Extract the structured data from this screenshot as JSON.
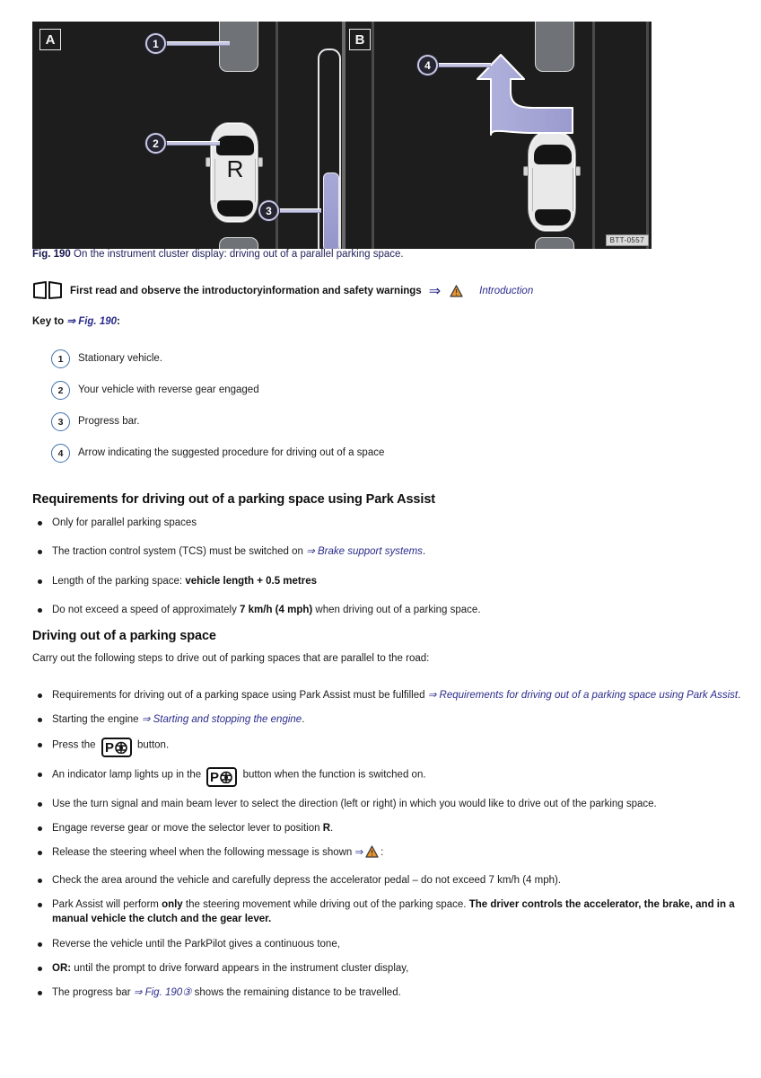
{
  "figure": {
    "panel_a_label": "A",
    "panel_b_label": "B",
    "gear_letter": "R",
    "watermark": "BTT-0557",
    "callouts": [
      "1",
      "2",
      "3",
      "4"
    ],
    "colors": {
      "background": "#1d1d1d",
      "arrow_fill": "#a9a9d8",
      "progress_fill": "#9494c9",
      "callout_ring": "#c9c9e6",
      "parked_vehicle": "#6f7377"
    }
  },
  "caption": {
    "label": "Fig. 190",
    "text": "On the instrument cluster display: driving out of a parallel parking space."
  },
  "note": {
    "icon": "book-icon",
    "text": "First read and observe the introductoryinformation and safety warnings",
    "ref_arrow": "⇒",
    "warning_icon": "warning-triangle-icon",
    "link": "Introduction"
  },
  "key_heading": {
    "prefix": "Key to ",
    "arrow": "⇒",
    "figure": "Fig. 190",
    "suffix": ":"
  },
  "key_items": [
    {
      "num": "1",
      "text": "Stationary vehicle."
    },
    {
      "num": "2",
      "text": "Your vehicle with reverse gear engaged"
    },
    {
      "num": "3",
      "text": "Progress bar."
    },
    {
      "num": "4",
      "text": "Arrow indicating the suggested procedure for driving out of a space"
    }
  ],
  "requirements": {
    "heading": "Requirements for driving out of a parking space using Park Assist",
    "bullets": [
      {
        "parts": [
          {
            "t": "Only for parallel parking spaces",
            "s": "n"
          }
        ]
      },
      {
        "parts": [
          {
            "t": "The traction control system (TCS) must be switched on ",
            "s": "n"
          },
          {
            "t": "⇒ Brake support systems",
            "s": "i"
          },
          {
            "t": ".",
            "s": "n"
          }
        ]
      },
      {
        "parts": [
          {
            "t": "Length of the parking space: ",
            "s": "n"
          },
          {
            "t": "vehicle length + 0.5 metres",
            "s": "b"
          }
        ]
      },
      {
        "parts": [
          {
            "t": "Do not exceed a speed of approximately ",
            "s": "n"
          },
          {
            "t": "7 km/h (4 mph)",
            "s": "b"
          },
          {
            "t": " when driving out of a parking space.",
            "s": "n"
          }
        ]
      }
    ]
  },
  "driving_out": {
    "heading": "Driving out of a parking space",
    "intro": "Carry out the following steps to drive out of parking spaces that are parallel to the road:",
    "bullets": [
      {
        "parts": [
          {
            "t": "Requirements for driving out of a parking space using Park Assist must be fulfilled ",
            "s": "n"
          },
          {
            "t": "⇒ Requirements for driving out of a parking space using Park Assist",
            "s": "i"
          },
          {
            "t": ".",
            "s": "n"
          }
        ]
      },
      {
        "parts": [
          {
            "t": "Starting the engine ",
            "s": "n"
          },
          {
            "t": "⇒ Starting and stopping the engine",
            "s": "i"
          },
          {
            "t": ".",
            "s": "n"
          }
        ]
      },
      {
        "parts": [
          {
            "t": "Press the ",
            "s": "n"
          },
          {
            "t": "park-assist-button-icon",
            "s": "icon"
          },
          {
            "t": " button.",
            "s": "n"
          }
        ]
      },
      {
        "parts": [
          {
            "t": "An indicator lamp lights up in the ",
            "s": "n"
          },
          {
            "t": "park-assist-button-icon",
            "s": "icon"
          },
          {
            "t": " button when the function is switched on.",
            "s": "n"
          }
        ]
      },
      {
        "parts": [
          {
            "t": "Use the turn signal and main beam lever to select the direction (left or right) in which you would like to drive out of the parking space.",
            "s": "n"
          }
        ]
      },
      {
        "parts": [
          {
            "t": "Engage reverse gear or move the selector lever to position ",
            "s": "n"
          },
          {
            "t": "R",
            "s": "b"
          },
          {
            "t": ".",
            "s": "n"
          }
        ]
      },
      {
        "parts": [
          {
            "t": "Release the steering wheel when the following message is shown ",
            "s": "n"
          },
          {
            "t": "⇒",
            "s": "ref"
          },
          {
            "t": "warning-triangle-icon",
            "s": "warn"
          },
          {
            "t": ":",
            "s": "n"
          }
        ]
      },
      {
        "parts": [
          {
            "t": "Check the area around the vehicle and carefully depress the accelerator pedal – do not exceed 7 km/h (4 mph).",
            "s": "n"
          }
        ]
      },
      {
        "parts": [
          {
            "t": "Park Assist will perform ",
            "s": "n"
          },
          {
            "t": "only",
            "s": "b"
          },
          {
            "t": " the steering movement while driving out of the parking space. ",
            "s": "n"
          },
          {
            "t": "The driver controls the accelerator, the brake, and in a manual vehicle the clutch and the gear lever.",
            "s": "b"
          }
        ]
      },
      {
        "parts": [
          {
            "t": "Reverse the vehicle until the ParkPilot gives a continuous tone,",
            "s": "n"
          }
        ]
      },
      {
        "parts": [
          {
            "t": "OR:",
            "s": "b"
          },
          {
            "t": " until the prompt to drive forward appears in the instrument cluster display,",
            "s": "n"
          }
        ]
      },
      {
        "parts": [
          {
            "t": "The progress bar ",
            "s": "n"
          },
          {
            "t": "⇒ Fig. 190③",
            "s": "i"
          },
          {
            "t": " shows the remaining distance to be travelled.",
            "s": "n"
          }
        ]
      }
    ]
  }
}
